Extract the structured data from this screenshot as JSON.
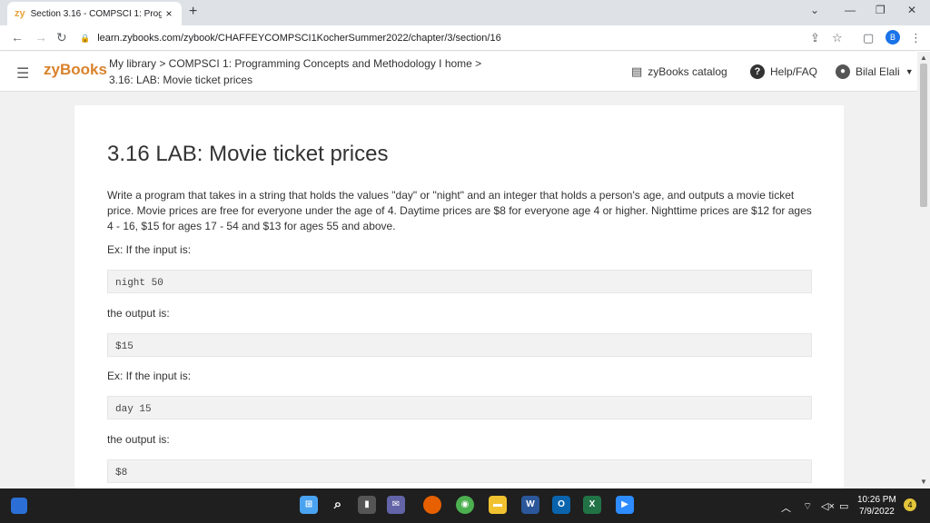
{
  "browser": {
    "tab_favicon": "zy",
    "tab_title": "Section 3.16 - COMPSCI 1: Progr",
    "tab_close": "×",
    "new_tab": "+",
    "url": "learn.zybooks.com/zybook/CHAFFEYCOMPSCI1KocherSummer2022/chapter/3/section/16",
    "profile_initial": "B"
  },
  "header": {
    "logo": "zyBooks",
    "breadcrumb_line1": "My library > COMPSCI 1: Programming Concepts and Methodology I home >",
    "breadcrumb_line2": "3.16: LAB: Movie ticket prices",
    "catalog": "zyBooks catalog",
    "help": "Help/FAQ",
    "user": "Bilal Elali"
  },
  "content": {
    "title": "3.16 LAB: Movie ticket prices",
    "description": "Write a program that takes in a string that holds the values \"day\" or \"night\" and an integer that holds a person's age, and outputs a movie ticket price. Movie prices are free for everyone under the age of 4. Daytime prices are $8 for everyone age 4 or higher. Nighttime prices are $12 for ages 4 - 16, $15 for ages 17 - 54 and $13 for ages 55 and above.",
    "examples": [
      {
        "input_label": "Ex: If the input is:",
        "input": "night 50",
        "output_label": "the output is:",
        "output": "$15"
      },
      {
        "input_label": "Ex: If the input is:",
        "input": "day 15",
        "output_label": "the output is:",
        "output": "$8"
      }
    ]
  },
  "taskbar": {
    "time": "10:26 PM",
    "date": "7/9/2022",
    "notifications": "4"
  }
}
